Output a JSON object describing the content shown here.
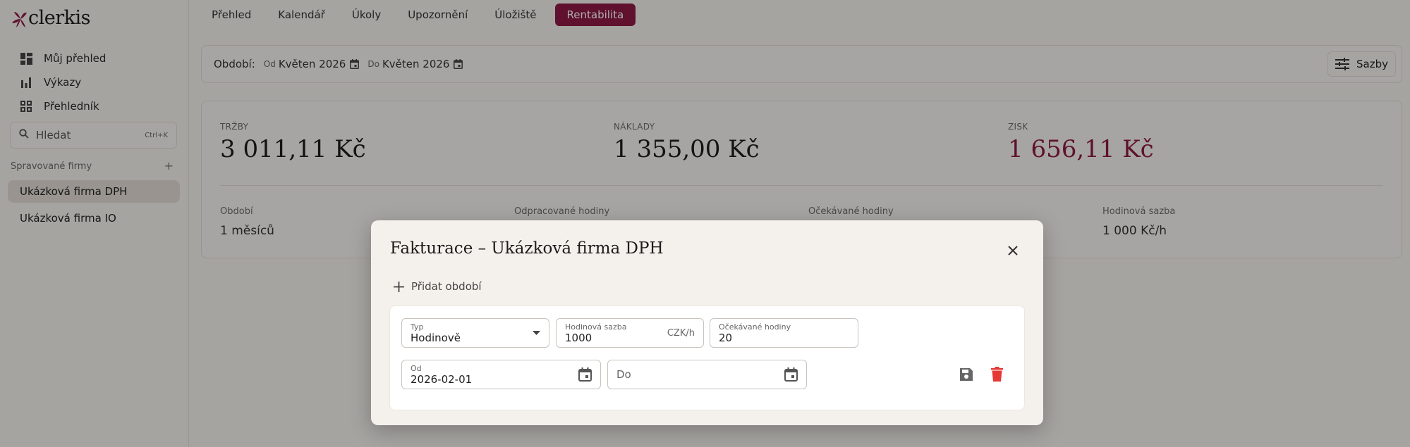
{
  "app": {
    "logo_text": "clerkis"
  },
  "sidebar": {
    "nav": [
      {
        "label": "Můj přehled",
        "icon": "dashboard-icon"
      },
      {
        "label": "Výkazy",
        "icon": "bar-chart-icon"
      },
      {
        "label": "Přehledník",
        "icon": "grid-icon"
      }
    ],
    "search": {
      "placeholder": "Hledat",
      "shortcut": "Ctrl+K"
    },
    "managed_title": "Spravované firmy",
    "add_symbol": "+",
    "firms": [
      {
        "label": "Ukázková firma DPH",
        "active": true
      },
      {
        "label": "Ukázková firma IO",
        "active": false
      }
    ]
  },
  "tabs": [
    {
      "label": "Přehled"
    },
    {
      "label": "Kalendář"
    },
    {
      "label": "Úkoly"
    },
    {
      "label": "Upozornění"
    },
    {
      "label": "Úložiště"
    },
    {
      "label": "Rentabilita",
      "active": true
    }
  ],
  "period": {
    "label": "Období:",
    "from_label": "Od",
    "from_value": "Květen 2026",
    "to_label": "Do",
    "to_value": "Květen 2026",
    "rates_button": "Sazby"
  },
  "summary": {
    "revenue_label": "TRŽBY",
    "revenue_value": "3 011,11 Kč",
    "costs_label": "NÁKLADY",
    "costs_value": "1 355,00 Kč",
    "profit_label": "ZISK",
    "profit_value": "1 656,11 Kč",
    "period_label": "Období",
    "period_value": "1 měsíců",
    "worked_label": "Odpracované hodiny",
    "expected_label": "Očekávané hodiny",
    "rate_label": "Hodinová sazba",
    "rate_value": "1 000 Kč/h"
  },
  "modal": {
    "title": "Fakturace – Ukázková firma DPH",
    "add_period": "Přidat období",
    "type_label": "Typ",
    "type_value": "Hodinově",
    "rate_label": "Hodinová sazba",
    "rate_value": "1000",
    "rate_suffix": "CZK/h",
    "hours_label": "Očekávané hodiny",
    "hours_value": "20",
    "from_label": "Od",
    "from_value": "2026-02-01",
    "to_placeholder": "Do"
  },
  "colors": {
    "accent": "#8c1a44",
    "delete": "#e53935",
    "overlay": "rgba(0,0,0,0.32)"
  }
}
